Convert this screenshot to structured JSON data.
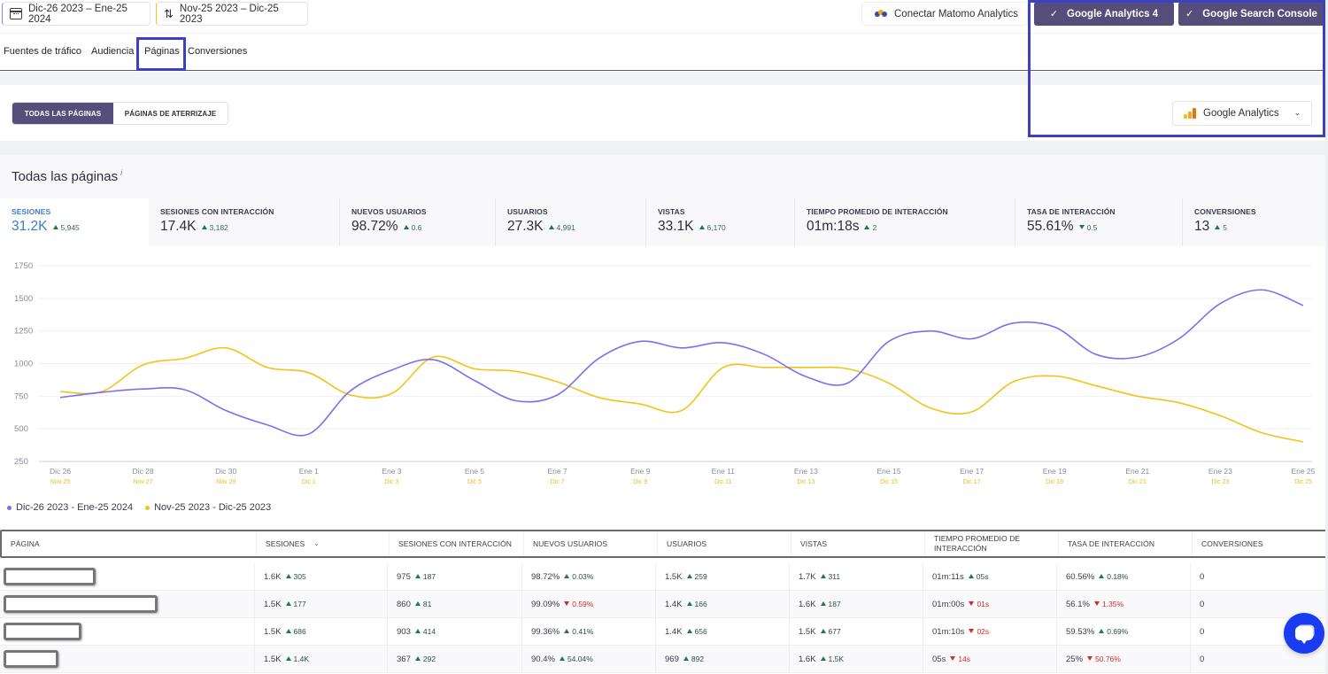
{
  "topbar": {
    "current_range": "Dic-26 2023 – Ene-25 2024",
    "compare_range": "Nov-25 2023 – Dic-25 2023",
    "matomo_label": "Conectar Matomo Analytics",
    "ga4_label": "Google Analytics 4",
    "gsc_label": "Google Search Console",
    "check_glyph": "✓",
    "icons": {
      "calendar": "calendar-icon",
      "compare": "sort-arrows-icon",
      "matomo": "matomo-logo-icon"
    },
    "compare_glyph": "⇅"
  },
  "nav": {
    "tabs": [
      {
        "label": "Fuentes de tráfico",
        "active": false
      },
      {
        "label": "Audiencia",
        "active": false
      },
      {
        "label": "Páginas",
        "active": true
      },
      {
        "label": "Conversiones",
        "active": false
      }
    ]
  },
  "filters": {
    "segments": [
      {
        "label": "TODAS LAS PÁGINAS",
        "active": true
      },
      {
        "label": "PÁGINAS DE ATERRIZAJE",
        "active": false
      }
    ],
    "source_select": "Google Analytics",
    "chevron": "⌄"
  },
  "section": {
    "title": "Todas las páginas",
    "info": "i"
  },
  "metrics": [
    {
      "label": "SESIONES",
      "value": "31.2K",
      "delta": "5,945",
      "dir": "up",
      "active": true
    },
    {
      "label": "SESIONES CON INTERACCIÓN",
      "value": "17.4K",
      "delta": "3,182",
      "dir": "up"
    },
    {
      "label": "NUEVOS USUARIOS",
      "value": "98.72%",
      "delta": "0.6",
      "dir": "up"
    },
    {
      "label": "USUARIOS",
      "value": "27.3K",
      "delta": "4,991",
      "dir": "up"
    },
    {
      "label": "VISTAS",
      "value": "33.1K",
      "delta": "6,170",
      "dir": "up"
    },
    {
      "label": "TIEMPO PROMEDIO DE INTERACCIÓN",
      "value": "01m:18s",
      "delta": "2",
      "dir": "up"
    },
    {
      "label": "TASA DE INTERACCIÓN",
      "value": "55.61%",
      "delta": "0.5",
      "dir": "down-good"
    },
    {
      "label": "CONVERSIONES",
      "value": "13",
      "delta": "5",
      "dir": "up"
    }
  ],
  "colors": {
    "current": "#7b6ff0",
    "previous": "#f2c318",
    "accent": "#564e7a",
    "highlight": "#3d3fc4",
    "positive": "#1e7a4e",
    "negative": "#d62828",
    "active_metric": "#3d7cc9"
  },
  "chart_data": {
    "type": "line",
    "title": "",
    "xlabel": "",
    "ylabel": "",
    "ylim": [
      250,
      1750
    ],
    "yticks": [
      250,
      500,
      750,
      1000,
      1250,
      1500,
      1750
    ],
    "grid": true,
    "legend_position": "bottom-left",
    "x_labels_primary": [
      "Dic 26",
      "Dic 28",
      "Dic 30",
      "Ene 1",
      "Ene 3",
      "Ene 5",
      "Ene 7",
      "Ene 9",
      "Ene 11",
      "Ene 13",
      "Ene 15",
      "Ene 17",
      "Ene 19",
      "Ene 21",
      "Ene 23",
      "Ene 25"
    ],
    "x_labels_secondary": [
      "Nov 25",
      "Nov 27",
      "Nov 29",
      "Dic 1",
      "Dic 3",
      "Dic 5",
      "Dic 7",
      "Dic 9",
      "Dic 11",
      "Dic 13",
      "Dic 15",
      "Dic 17",
      "Dic 19",
      "Dic 21",
      "Dic 23",
      "Dic 25"
    ],
    "days": 31,
    "series": [
      {
        "name": "Dic-26 2023 - Ene-25 2024",
        "values": [
          740,
          780,
          805,
          800,
          640,
          530,
          460,
          790,
          950,
          1030,
          870,
          715,
          760,
          1040,
          1170,
          1120,
          1160,
          1070,
          900,
          850,
          1170,
          1250,
          1190,
          1310,
          1280,
          1070,
          1050,
          1190,
          1460,
          1565,
          1445
        ]
      },
      {
        "name": "Nov-25 2023 - Dic-25 2023",
        "values": [
          785,
          785,
          990,
          1040,
          1120,
          970,
          930,
          760,
          770,
          1050,
          960,
          940,
          860,
          740,
          690,
          640,
          970,
          970,
          970,
          960,
          850,
          660,
          630,
          860,
          905,
          830,
          750,
          700,
          600,
          470,
          400
        ]
      }
    ]
  },
  "table": {
    "headers": [
      "PÁGINA",
      "SESIONES",
      "SESIONES CON INTERACCIÓN",
      "NUEVOS USUARIOS",
      "USUARIOS",
      "VISTAS",
      "TIEMPO PROMEDIO DE INTERACCIÓN",
      "TASA DE INTERACCIÓN",
      "CONVERSIONES"
    ],
    "sort_glyph": "⌄",
    "rows": [
      {
        "page": "[redacted]",
        "cells": [
          {
            "v": "1.6K",
            "d": "305",
            "dir": "up"
          },
          {
            "v": "975",
            "d": "187",
            "dir": "up"
          },
          {
            "v": "98.72%",
            "d": "0.03%",
            "dir": "up"
          },
          {
            "v": "1.5K",
            "d": "259",
            "dir": "up"
          },
          {
            "v": "1.7K",
            "d": "311",
            "dir": "up"
          },
          {
            "v": "01m:11s",
            "d": "05s",
            "dir": "up"
          },
          {
            "v": "60.56%",
            "d": "0.18%",
            "dir": "up"
          },
          {
            "v": "0",
            "d": "",
            "dir": ""
          }
        ]
      },
      {
        "page": "[redacted]",
        "cells": [
          {
            "v": "1.5K",
            "d": "177",
            "dir": "up"
          },
          {
            "v": "860",
            "d": "81",
            "dir": "up"
          },
          {
            "v": "99.09%",
            "d": "0.59%",
            "dir": "down"
          },
          {
            "v": "1.4K",
            "d": "166",
            "dir": "up"
          },
          {
            "v": "1.6K",
            "d": "187",
            "dir": "up"
          },
          {
            "v": "01m:00s",
            "d": "01s",
            "dir": "down"
          },
          {
            "v": "56.1%",
            "d": "1.35%",
            "dir": "down"
          },
          {
            "v": "0",
            "d": "",
            "dir": ""
          }
        ]
      },
      {
        "page": "[redacted]",
        "cells": [
          {
            "v": "1.5K",
            "d": "686",
            "dir": "up"
          },
          {
            "v": "903",
            "d": "414",
            "dir": "up"
          },
          {
            "v": "99.36%",
            "d": "0.41%",
            "dir": "up"
          },
          {
            "v": "1.4K",
            "d": "656",
            "dir": "up"
          },
          {
            "v": "1.5K",
            "d": "677",
            "dir": "up"
          },
          {
            "v": "01m:10s",
            "d": "02s",
            "dir": "down"
          },
          {
            "v": "59.53%",
            "d": "0.69%",
            "dir": "up"
          },
          {
            "v": "0",
            "d": "",
            "dir": ""
          }
        ]
      },
      {
        "page": "[redacted]",
        "cells": [
          {
            "v": "1.5K",
            "d": "1.4K",
            "dir": "up"
          },
          {
            "v": "367",
            "d": "292",
            "dir": "up"
          },
          {
            "v": "90.4%",
            "d": "54.04%",
            "dir": "up"
          },
          {
            "v": "969",
            "d": "892",
            "dir": "up"
          },
          {
            "v": "1.6K",
            "d": "1.5K",
            "dir": "up"
          },
          {
            "v": "05s",
            "d": "14s",
            "dir": "down"
          },
          {
            "v": "25%",
            "d": "50.76%",
            "dir": "down"
          },
          {
            "v": "0",
            "d": "",
            "dir": ""
          }
        ]
      }
    ]
  }
}
